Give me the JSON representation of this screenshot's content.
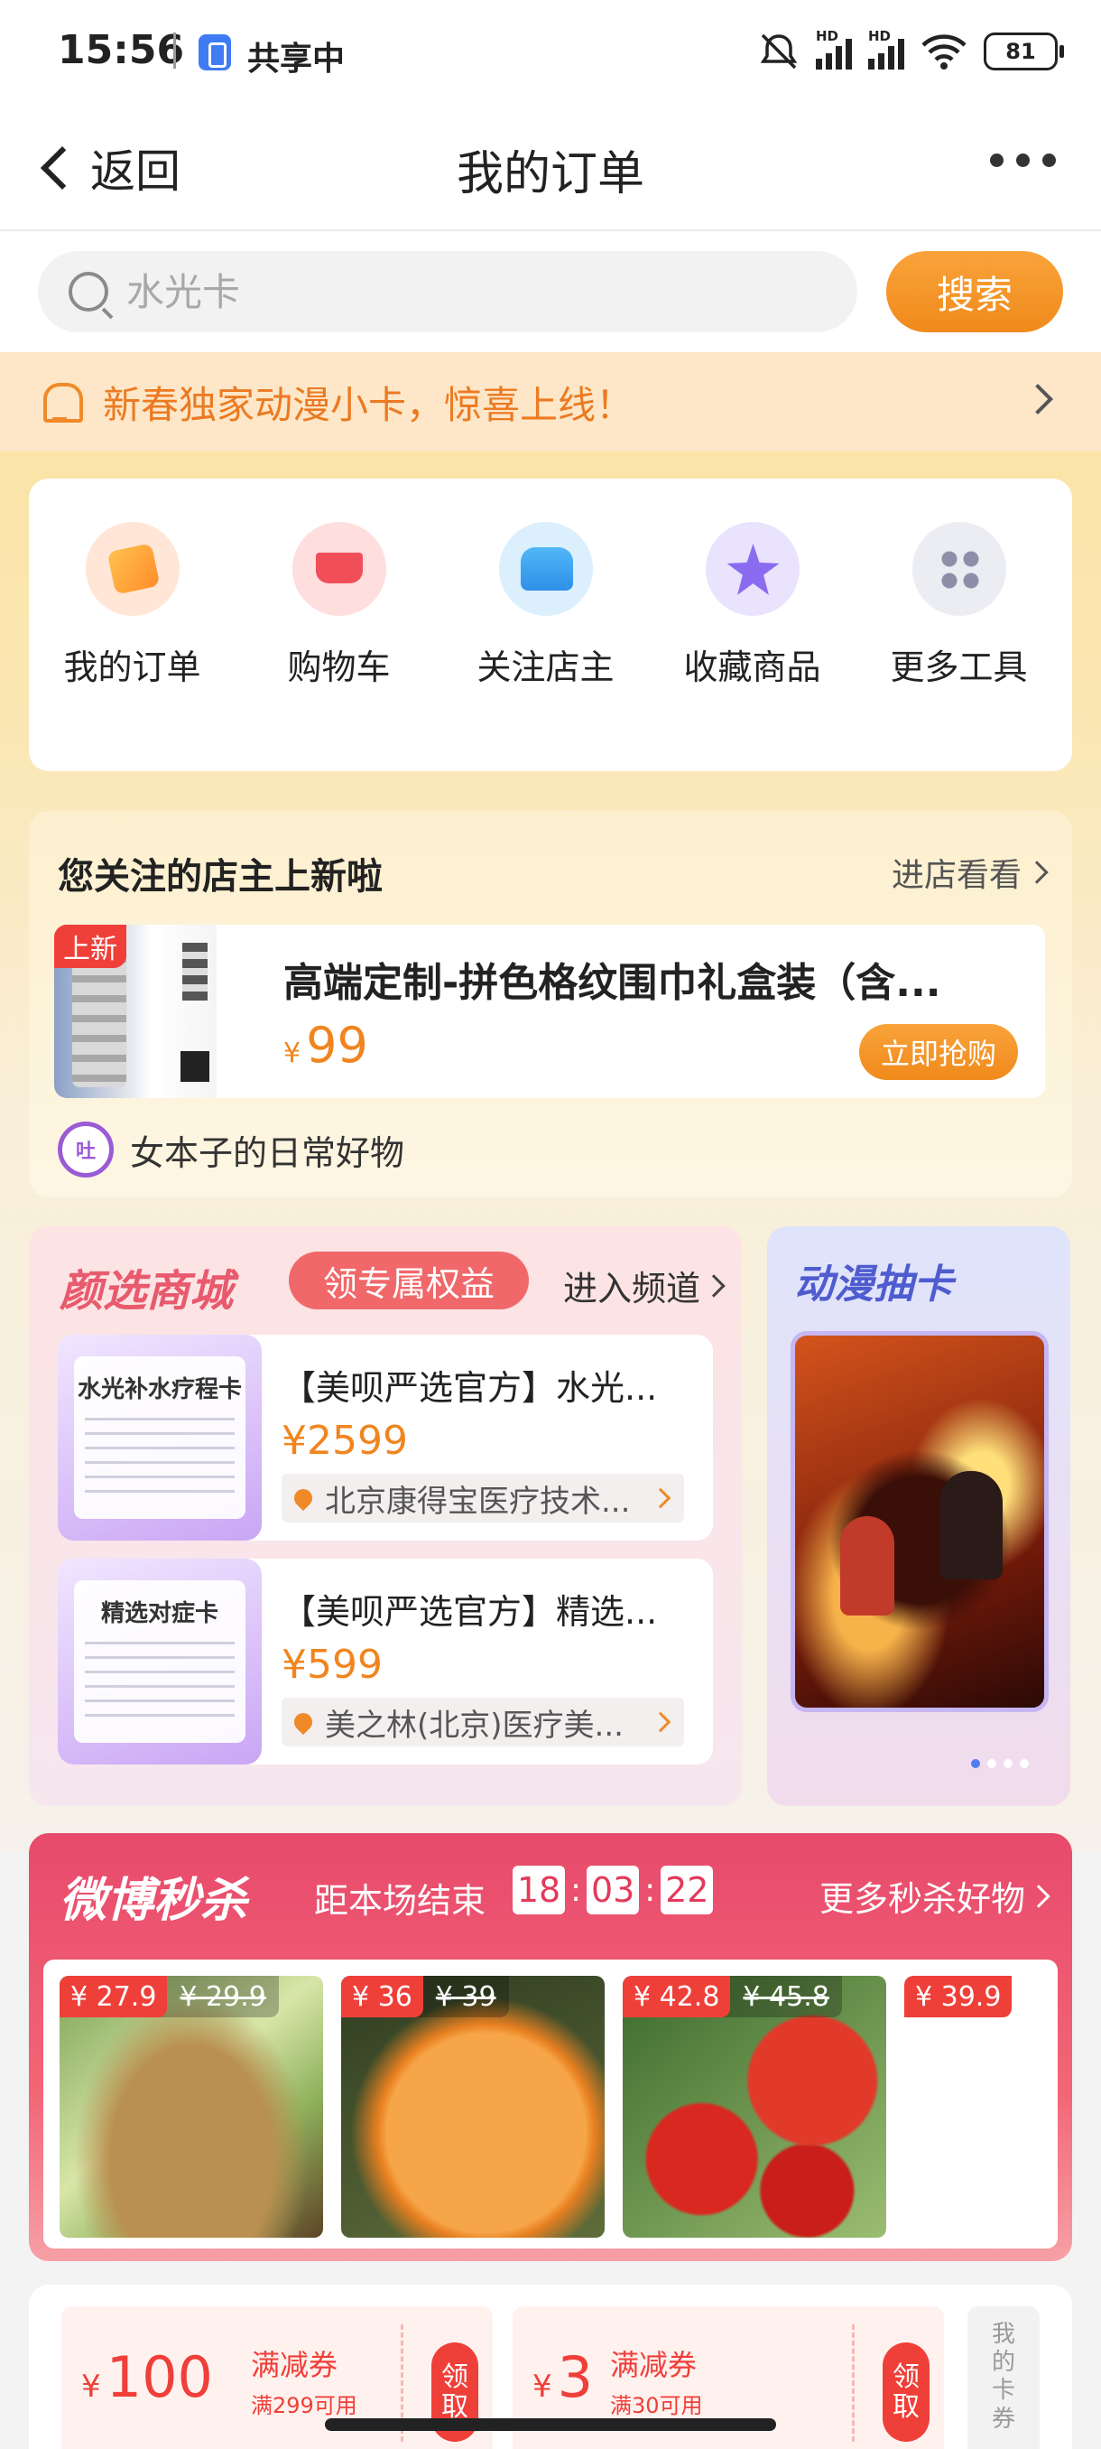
{
  "status_bar": {
    "time": "15:56",
    "share_label": "共享中",
    "battery": "81",
    "signal_label": "HD"
  },
  "nav": {
    "back_label": "返回",
    "title": "我的订单"
  },
  "search": {
    "placeholder": "水光卡",
    "button_label": "搜索"
  },
  "notice": {
    "text": "新春独家动漫小卡，惊喜上线！"
  },
  "tools": [
    {
      "label": "我的订单",
      "icon": "shopping-bag-icon"
    },
    {
      "label": "购物车",
      "icon": "shopping-cart-icon"
    },
    {
      "label": "关注店主",
      "icon": "store-icon"
    },
    {
      "label": "收藏商品",
      "icon": "star-icon"
    },
    {
      "label": "更多工具",
      "icon": "grid-icon"
    }
  ],
  "follow": {
    "title": "您关注的店主上新啦",
    "link": "进店看看",
    "product": {
      "badge": "上新",
      "name": "高端定制-拼色格纹围巾礼盒装（含...",
      "currency": "¥",
      "price": "99",
      "buy_label": "立即抢购"
    },
    "shop": {
      "avatar_text": "吐",
      "name": "女本子的日常好物"
    }
  },
  "mall": {
    "title": "颜选商城",
    "tag": "领专属权益",
    "link": "进入频道",
    "items": [
      {
        "image_caption": "水光补水疗程卡",
        "name": "【美呗严选官方】水光...",
        "price": "¥2599",
        "store": "北京康得宝医疗技术..."
      },
      {
        "image_caption": "精选对症卡",
        "name": "【美呗严选官方】精选...",
        "price": "¥599",
        "store": "美之林(北京)医疗美..."
      }
    ]
  },
  "anime": {
    "title": "动漫抽卡",
    "slides": 4,
    "active_slide": 1
  },
  "flash": {
    "title": "微博秒杀",
    "subtitle": "距本场结束",
    "timer": {
      "h": "18",
      "m": "03",
      "s": "22"
    },
    "link": "更多秒杀好物",
    "items": [
      {
        "price": "¥ 27.9",
        "old_price": "¥ 29.9",
        "image": "cucumbers"
      },
      {
        "price": "¥ 36",
        "old_price": "¥ 39",
        "image": "oranges"
      },
      {
        "price": "¥ 42.8",
        "old_price": "¥ 45.8",
        "image": "tomatoes"
      },
      {
        "price": "¥ 39.9",
        "old_price": "",
        "image": ""
      }
    ]
  },
  "coupons": [
    {
      "currency": "¥",
      "amount": "100",
      "title": "满减券",
      "condition": "满299可用",
      "claim": "领取"
    },
    {
      "currency": "¥",
      "amount": "3",
      "title": "满减券",
      "condition": "满30可用",
      "claim": "领取"
    }
  ],
  "my_cards": "我的卡券",
  "colors": {
    "accent": "#f08a1b",
    "sale": "#e84a6c",
    "price": "#f0851f"
  }
}
